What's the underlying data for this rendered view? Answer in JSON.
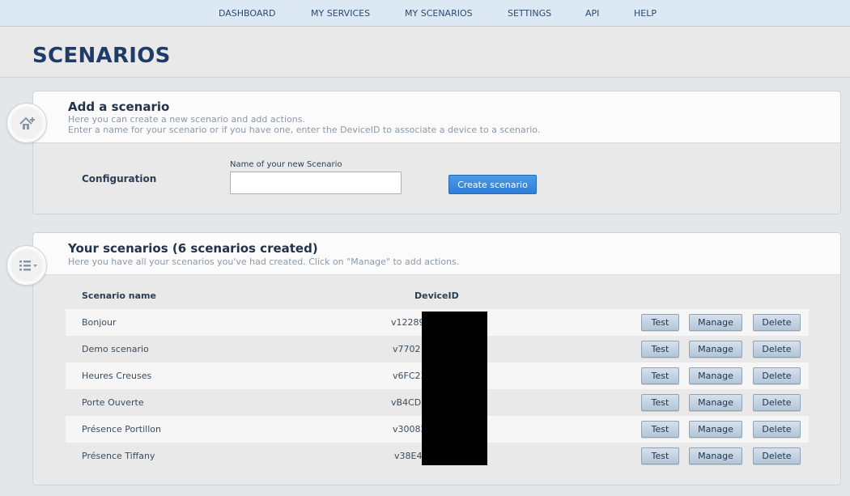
{
  "nav": {
    "items": [
      "DASHBOARD",
      "MY SERVICES",
      "MY SCENARIOS",
      "SETTINGS",
      "API",
      "HELP"
    ]
  },
  "page": {
    "title": "SCENARIOS"
  },
  "add_panel": {
    "icon": "home-add-icon",
    "title": "Add a scenario",
    "desc_line1": "Here you can create a new scenario and add actions.",
    "desc_line2": "Enter a name for your scenario or if you have one, enter the DeviceID to associate a device to a scenario.",
    "config_label": "Configuration",
    "field_label": "Name of your new Scenario",
    "field_value": "",
    "create_button": "Create scenario"
  },
  "list_panel": {
    "icon": "list-icon",
    "title": "Your scenarios (6 scenarios created)",
    "desc": "Here you have all your scenarios you've had created. Click on \"Manage\" to add actions.",
    "col_name": "Scenario name",
    "col_device": "DeviceID",
    "btn_test": "Test",
    "btn_manage": "Manage",
    "btn_delete": "Delete",
    "rows": [
      {
        "name": "Bonjour",
        "device": "v12289"
      },
      {
        "name": "Demo scenario",
        "device": "v7702"
      },
      {
        "name": "Heures Creuses",
        "device": "v6FC23"
      },
      {
        "name": "Porte Ouverte",
        "device": "vB4CD"
      },
      {
        "name": "Présence Portillon",
        "device": "v30082"
      },
      {
        "name": "Présence Tiffany",
        "device": "v38E4"
      }
    ]
  },
  "colors": {
    "nav_bg": "#dde8f5",
    "title": "#1f3b6a",
    "primary_button": "#2f7ed8",
    "secondary_button": "#b3c5d6"
  }
}
